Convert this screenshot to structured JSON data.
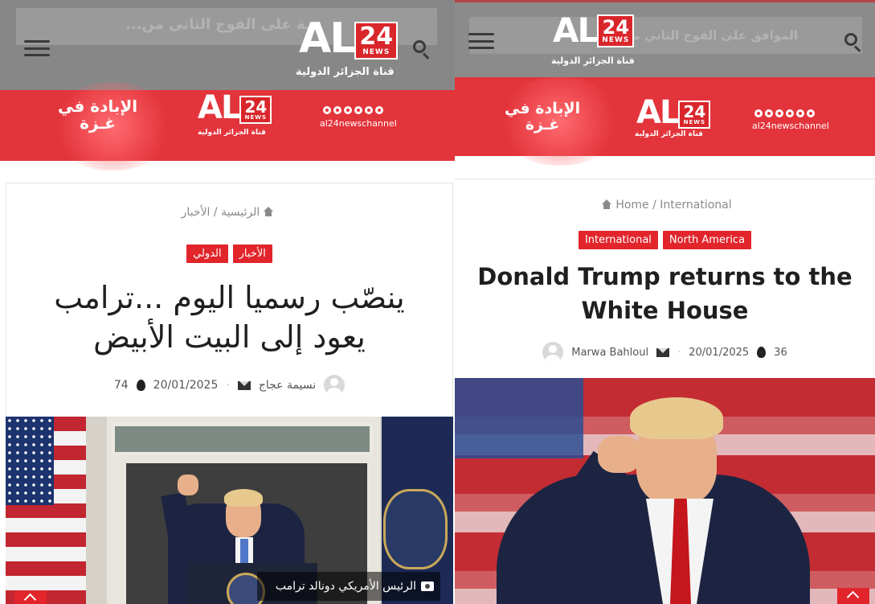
{
  "left": {
    "ghost_title": "ـة على الفوج الثاني من...",
    "logo": {
      "al": "AL",
      "num": "24",
      "news": "NEWS",
      "subtitle": "قناة الجزائر الدولية"
    },
    "banner": {
      "gaza_line1": "الإبادة في",
      "gaza_line2": "غـزة",
      "handle": "al24newschannel"
    },
    "breadcrumb": {
      "home": "الرئيسية",
      "sep": "/",
      "section": "الأخبار"
    },
    "tags": [
      "الأخبار",
      "الدولي"
    ],
    "headline_line1": "ينصّب رسميا اليوم ...ترامب",
    "headline_line2": "يعود إلى البيت الأبيض",
    "meta": {
      "author": "نسيمة عجاج",
      "date": "20/01/2025",
      "views": "74",
      "sep": "·"
    },
    "caption": "الرئيس الأمريكي دونالد ترامب"
  },
  "right": {
    "ghost_title": "الموافق على الفوج الثاني من...",
    "logo": {
      "al": "AL",
      "num": "24",
      "news": "NEWS",
      "subtitle": "قناة الجزائر الدولية"
    },
    "banner": {
      "gaza_line1": "الإبادة في",
      "gaza_line2": "غـزة",
      "handle": "al24newschannel"
    },
    "breadcrumb": {
      "home": "Home",
      "sep": "/",
      "section": "International"
    },
    "tags": [
      "International",
      "North America"
    ],
    "headline_line1": "Donald Trump returns to the",
    "headline_line2": "White House",
    "meta": {
      "author": "Marwa Bahloul",
      "date": "20/01/2025",
      "views": "36",
      "sep": "·"
    }
  },
  "colors": {
    "brand_red": "#e1252b",
    "header_gray": "#878787",
    "headline": "#1f1f1f"
  }
}
